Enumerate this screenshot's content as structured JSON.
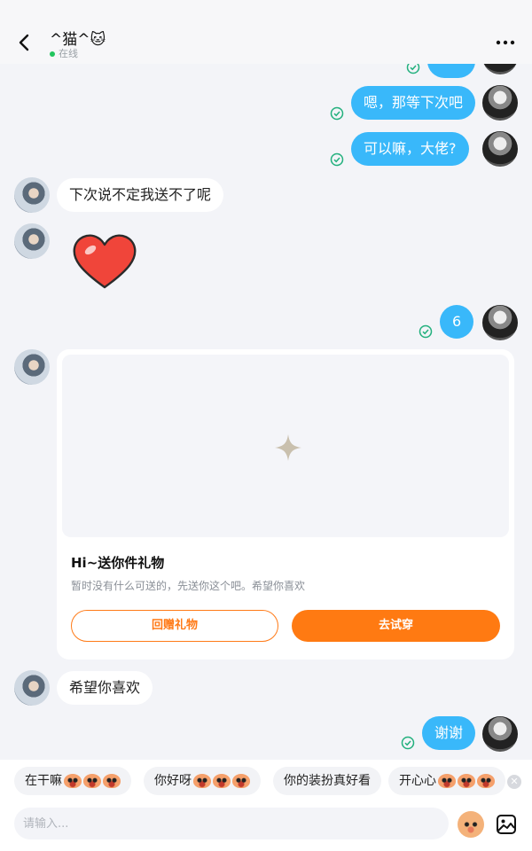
{
  "header": {
    "title": "^猫^🐱",
    "status": "在线"
  },
  "messages": [
    {
      "from": "me",
      "text": "嗯，那等下次吧"
    },
    {
      "from": "me",
      "text": "可以嘛，大佬?"
    },
    {
      "from": "them",
      "text": "下次说不定我送不了呢"
    },
    {
      "from": "them",
      "type": "sticker",
      "sticker": "red-heart"
    },
    {
      "from": "me",
      "text": "6"
    },
    {
      "from": "them",
      "type": "gift_card"
    },
    {
      "from": "them",
      "text": "希望你喜欢"
    },
    {
      "from": "me",
      "text": "谢谢"
    }
  ],
  "gift_card": {
    "title": "Hi~送你件礼物",
    "description": "暂时没有什么可送的，先送你这个吧。希望你喜欢",
    "return_gift_label": "回赠礼物",
    "try_on_label": "去试穿"
  },
  "quick_replies": [
    "在干嘛",
    "你好呀",
    "你的装扮真好看",
    "开心心"
  ],
  "input": {
    "placeholder": "请输入..."
  },
  "colors": {
    "my_bubble": "#39b8fa",
    "accent_orange": "#ff7a12",
    "online_dot": "#22c55e",
    "read_check": "#22b07d"
  }
}
